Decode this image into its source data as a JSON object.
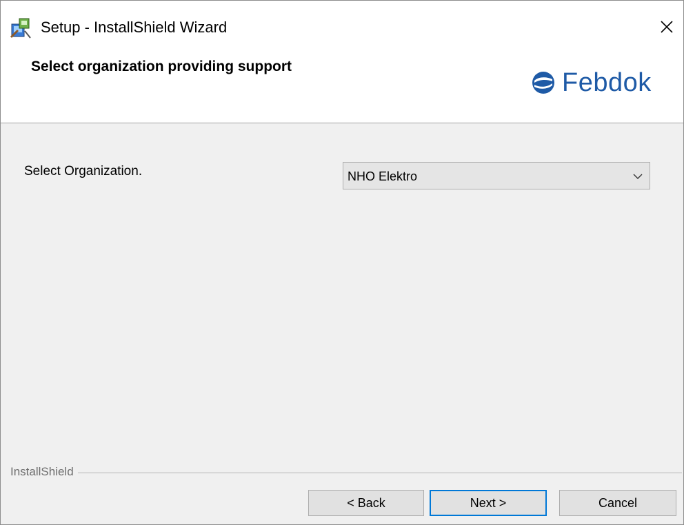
{
  "window": {
    "title": "Setup - InstallShield Wizard",
    "app_icon": "installer-icon",
    "close_icon": "close-icon"
  },
  "header": {
    "title": "Select organization providing support",
    "logo": {
      "text": "Febdok",
      "icon": "febdok-logo-icon",
      "color": "#1e5aa6"
    }
  },
  "form": {
    "organization_label": "Select Organization.",
    "organization_select": {
      "selected": "NHO Elektro",
      "icon": "chevron-down-icon"
    }
  },
  "footer": {
    "brand": "InstallShield",
    "back_label": "< Back",
    "next_label": "Next >",
    "cancel_label": "Cancel",
    "focus_color": "#0078d7"
  }
}
